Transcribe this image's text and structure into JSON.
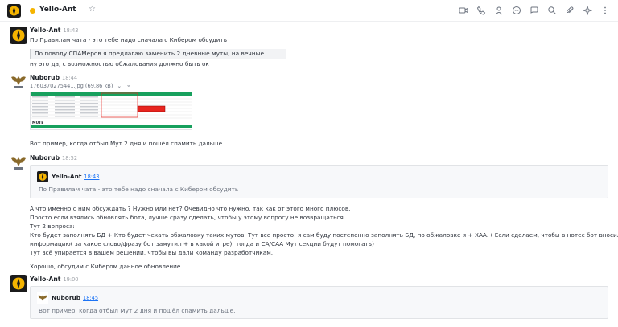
{
  "header": {
    "room_name": "Yello-Ant",
    "icons": [
      "video-call-icon",
      "phone-icon",
      "members-icon",
      "discussion-icon",
      "threads-icon",
      "search-icon",
      "attachment-icon",
      "apps-icon",
      "kebab-icon"
    ]
  },
  "messages": [
    {
      "user": "Yello-Ant",
      "time": "18:43",
      "line1": "По Правилам чата - это тебе надо сначала с Кибером обсудить",
      "quote": "По поводу СПАМеров я предлагаю заменить 2 дневные муты, на вечные.",
      "line2": "ну это да, с возможностью обжалования должно быть ок"
    },
    {
      "user": "Nuborub",
      "time": "18:44",
      "file_name": "1760370275441.jpg (69.86 kB)",
      "file_caption": "Вот пример, когда отбыл Мут 2 дня и пошёл спамить дальше.",
      "shot_label": "MUTE"
    },
    {
      "user": "Nuborub",
      "time": "18:52",
      "quoted_user": "Yello-Ant",
      "quoted_time": "18:43",
      "quoted_text": "По Правилам чата - это тебе надо сначала с Кибером обсудить",
      "body": [
        "А что именно с ним обсуждать ? Нужно или нет? Очевидно что нужно, так как от этого много плюсов.",
        "Просто если взялись обновлять бота, лучше сразу сделать, чтобы у этому вопросу не возвращаться.",
        "Тут 2 вопроса:",
        "Кто будет заполнять БД + Кто будет чекать обжаловку таких мутов. Тут все просто: я сам буду постепенно заполнять БД, по обжаловке я + ХАА. ( Если сделаем, чтобы в нотес бот вносил полную",
        "информацию( за какое слово/фразу бот замутил + в какой игре), тогда и СА/САА Мут секции будут помогать)",
        "Тут всё упирается в вашем решении, чтобы вы дали команду разработчикам.",
        "",
        "Хорошо, обсудим с Кибером данное обновление"
      ]
    },
    {
      "user": "Yello-Ant",
      "time": "19:00",
      "quoted_user": "Nuborub",
      "quoted_time": "18:45",
      "quoted_text": "Вот пример, когда отбыл Мут 2 дня и пошёл спамить дальше."
    }
  ],
  "colors": {
    "accent": "#1d74f5",
    "status": "#f5b400",
    "table_green": "#17a05d",
    "highlight_red": "#e8251f"
  }
}
